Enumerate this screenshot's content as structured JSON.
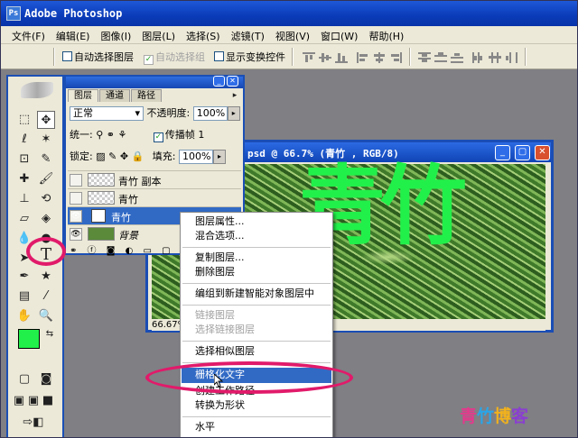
{
  "app": {
    "title": "Adobe Photoshop"
  },
  "menu": [
    "文件(F)",
    "编辑(E)",
    "图像(I)",
    "图层(L)",
    "选择(S)",
    "滤镜(T)",
    "视图(V)",
    "窗口(W)",
    "帮助(H)"
  ],
  "options": {
    "auto_select_layer": "自动选择图层",
    "auto_select_group": "自动选择组",
    "show_transform": "显示变换控件"
  },
  "layers_panel": {
    "tabs": [
      "图层",
      "通道",
      "路径"
    ],
    "blend_mode": "正常",
    "opacity_label": "不透明度:",
    "opacity_value": "100%",
    "unify_label": "统一:",
    "propagate_frame": "传播帧 1",
    "lock_label": "锁定:",
    "fill_label": "填充:",
    "fill_value": "100%",
    "layers": [
      "青竹 副本",
      "青竹",
      "青竹",
      "背景"
    ]
  },
  "document": {
    "title": "psd @ 66.7% (青竹 , RGB/8)",
    "zoom": "66.67%",
    "canvas_text": "青竹"
  },
  "context_menu": {
    "items": [
      "图层属性...",
      "混合选项...",
      "复制图层...",
      "删除图层",
      "编组到新建智能对象图层中",
      "链接图层",
      "选择链接图层",
      "选择相似图层",
      "栅格化文字",
      "创建工作路径",
      "转换为形状",
      "水平"
    ],
    "highlighted": "栅格化文字"
  },
  "watermark": "青竹博客",
  "colors": {
    "foreground": "#22f04a",
    "background": "#8a8a8a",
    "highlight_ring": "#e11a6a",
    "title_bar": "#0a3bb8"
  }
}
